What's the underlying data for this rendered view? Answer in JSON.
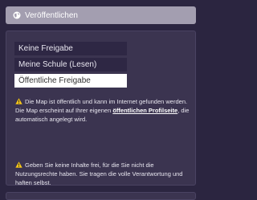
{
  "panel": {
    "title": "Veröffentlichen",
    "icon": "globe-icon"
  },
  "visibility": {
    "options": [
      {
        "label": "Keine Freigabe",
        "selected": false
      },
      {
        "label": "Meine Schule (Lesen)",
        "selected": false
      },
      {
        "label": "Öffentliche Freigabe",
        "selected": true
      }
    ]
  },
  "notices": [
    {
      "icon": "warning-icon",
      "text_before": "Die Map ist öffentlich und kann im Internet gefunden werden. Die Map erscheint auf Ihrer eigenen ",
      "link_text": "öffentlichen Profilseite",
      "text_after": ", die automatisch angelegt wird."
    },
    {
      "icon": "warning-icon",
      "text": "Geben Sie keine Inhalte frei, für die Sie nicht die Nutzungsrechte haben. Sie tragen die volle Verantwortung und haften selbst."
    }
  ],
  "colors": {
    "background": "#2b2540",
    "header": "#a39eb0",
    "panel": "#3b3450",
    "option": "#2e2744",
    "selected_option": "#ffffff",
    "warning": "#f5c518"
  }
}
